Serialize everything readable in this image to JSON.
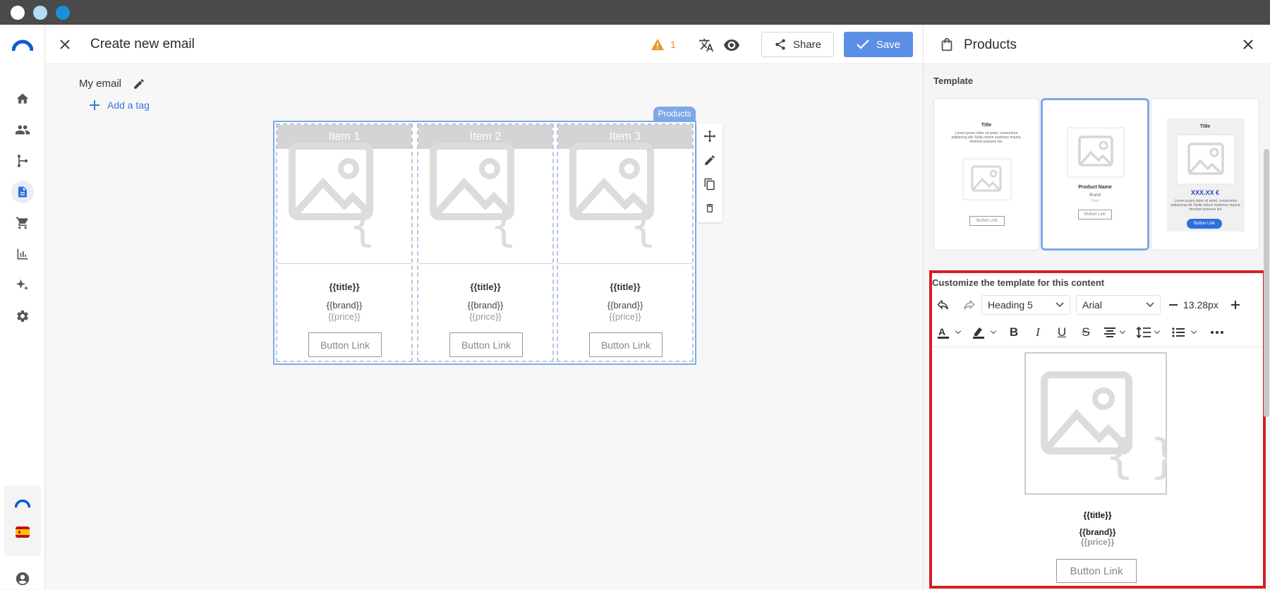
{
  "window": {
    "dots": [
      "#ffffff",
      "#b3dcf5",
      "#1b8fd8"
    ]
  },
  "header": {
    "title": "Create new email",
    "warning_count": "1",
    "share_label": "Share",
    "save_label": "Save"
  },
  "email": {
    "name": "My email",
    "add_tag_label": "Add a tag"
  },
  "canvas": {
    "block_badge": "Products",
    "items": [
      {
        "header": "Item 1",
        "title": "{{title}}",
        "brand": "{{brand}}",
        "price": "{{price}}",
        "button": "Button Link"
      },
      {
        "header": "Item 2",
        "title": "{{title}}",
        "brand": "{{brand}}",
        "price": "{{price}}",
        "button": "Button Link"
      },
      {
        "header": "Item 3",
        "title": "{{title}}",
        "brand": "{{brand}}",
        "price": "{{price}}",
        "button": "Button Link"
      }
    ]
  },
  "panel": {
    "title": "Products",
    "template_label": "Template",
    "templates": [
      {
        "title": "Title",
        "body": "Lorem ipsum dolor sit amet, consectetur adipiscing elit. Nulla rutrum maximus mauris, tincidunt posuere leo.",
        "button": "Button Link"
      },
      {
        "name": "Product Name",
        "brand": "Brand",
        "price": "Price",
        "button": "Button Link"
      },
      {
        "title": "Title",
        "price": "XXX.XX €",
        "body": "Lorem ipsum dolor sit amet, consectetur adipiscing elit. Nulla rutrum maximus mauris, tincidunt posuere leo.",
        "button": "Button Link"
      }
    ],
    "customize_label": "Customize the template for this content",
    "toolbar": {
      "heading_value": "Heading 5",
      "font_value": "Arial",
      "font_size": "13.28px"
    },
    "preview": {
      "title": "{{title}}",
      "brand": "{{brand}}",
      "price": "{{price}}",
      "button": "Button Link"
    }
  },
  "colors": {
    "accent": "#5b8fe6",
    "highlight_border": "#d51f26",
    "warning": "#e8962a"
  }
}
